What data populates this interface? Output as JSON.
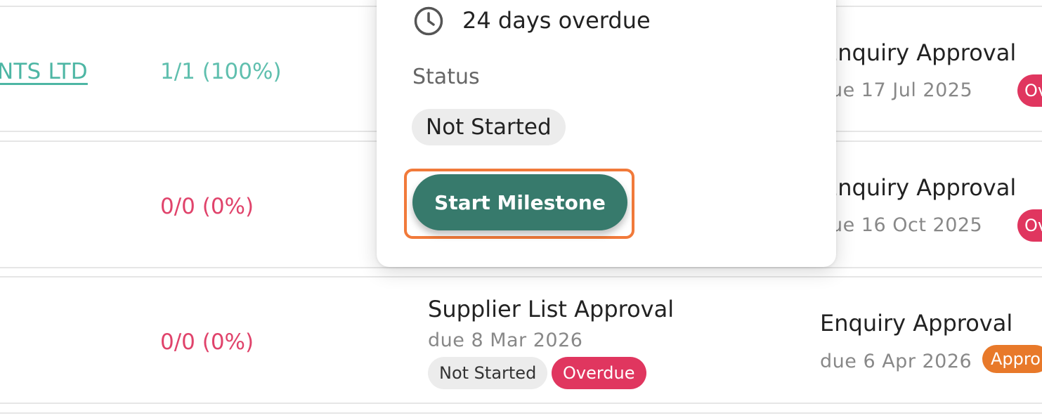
{
  "rows": [
    {
      "client": "NTS LTD",
      "progress": "1/1 (100%)",
      "next_milestone": {
        "title": "Enquiry Approval",
        "due": "ue 17 Jul 2025",
        "badge": "Ov"
      }
    },
    {
      "progress": "0/0 (0%)",
      "next_milestone": {
        "title": "Enquiry Approval",
        "due": "ue 16 Oct 2025",
        "badge": "Ov"
      }
    },
    {
      "progress": "0/0 (0%)",
      "current_milestone": {
        "title": "Supplier List Approval",
        "due": "due 8 Mar 2026",
        "status_badge": "Not Started",
        "overdue_badge": "Overdue"
      },
      "next_milestone": {
        "title": "Enquiry Approval",
        "due": "due 6 Apr 2026",
        "badge": "Appro"
      }
    }
  ],
  "popover": {
    "overdue_text": "24 days overdue",
    "status_label": "Status",
    "status_value": "Not Started",
    "action_label": "Start Milestone"
  },
  "colors": {
    "accent_teal": "#377a6c",
    "link_teal": "#4db6a4",
    "overdue_red": "#e0365f",
    "approval_orange": "#e8792a",
    "highlight_orange": "#f17a3a"
  },
  "icons": {
    "overdue": "clock-icon"
  }
}
